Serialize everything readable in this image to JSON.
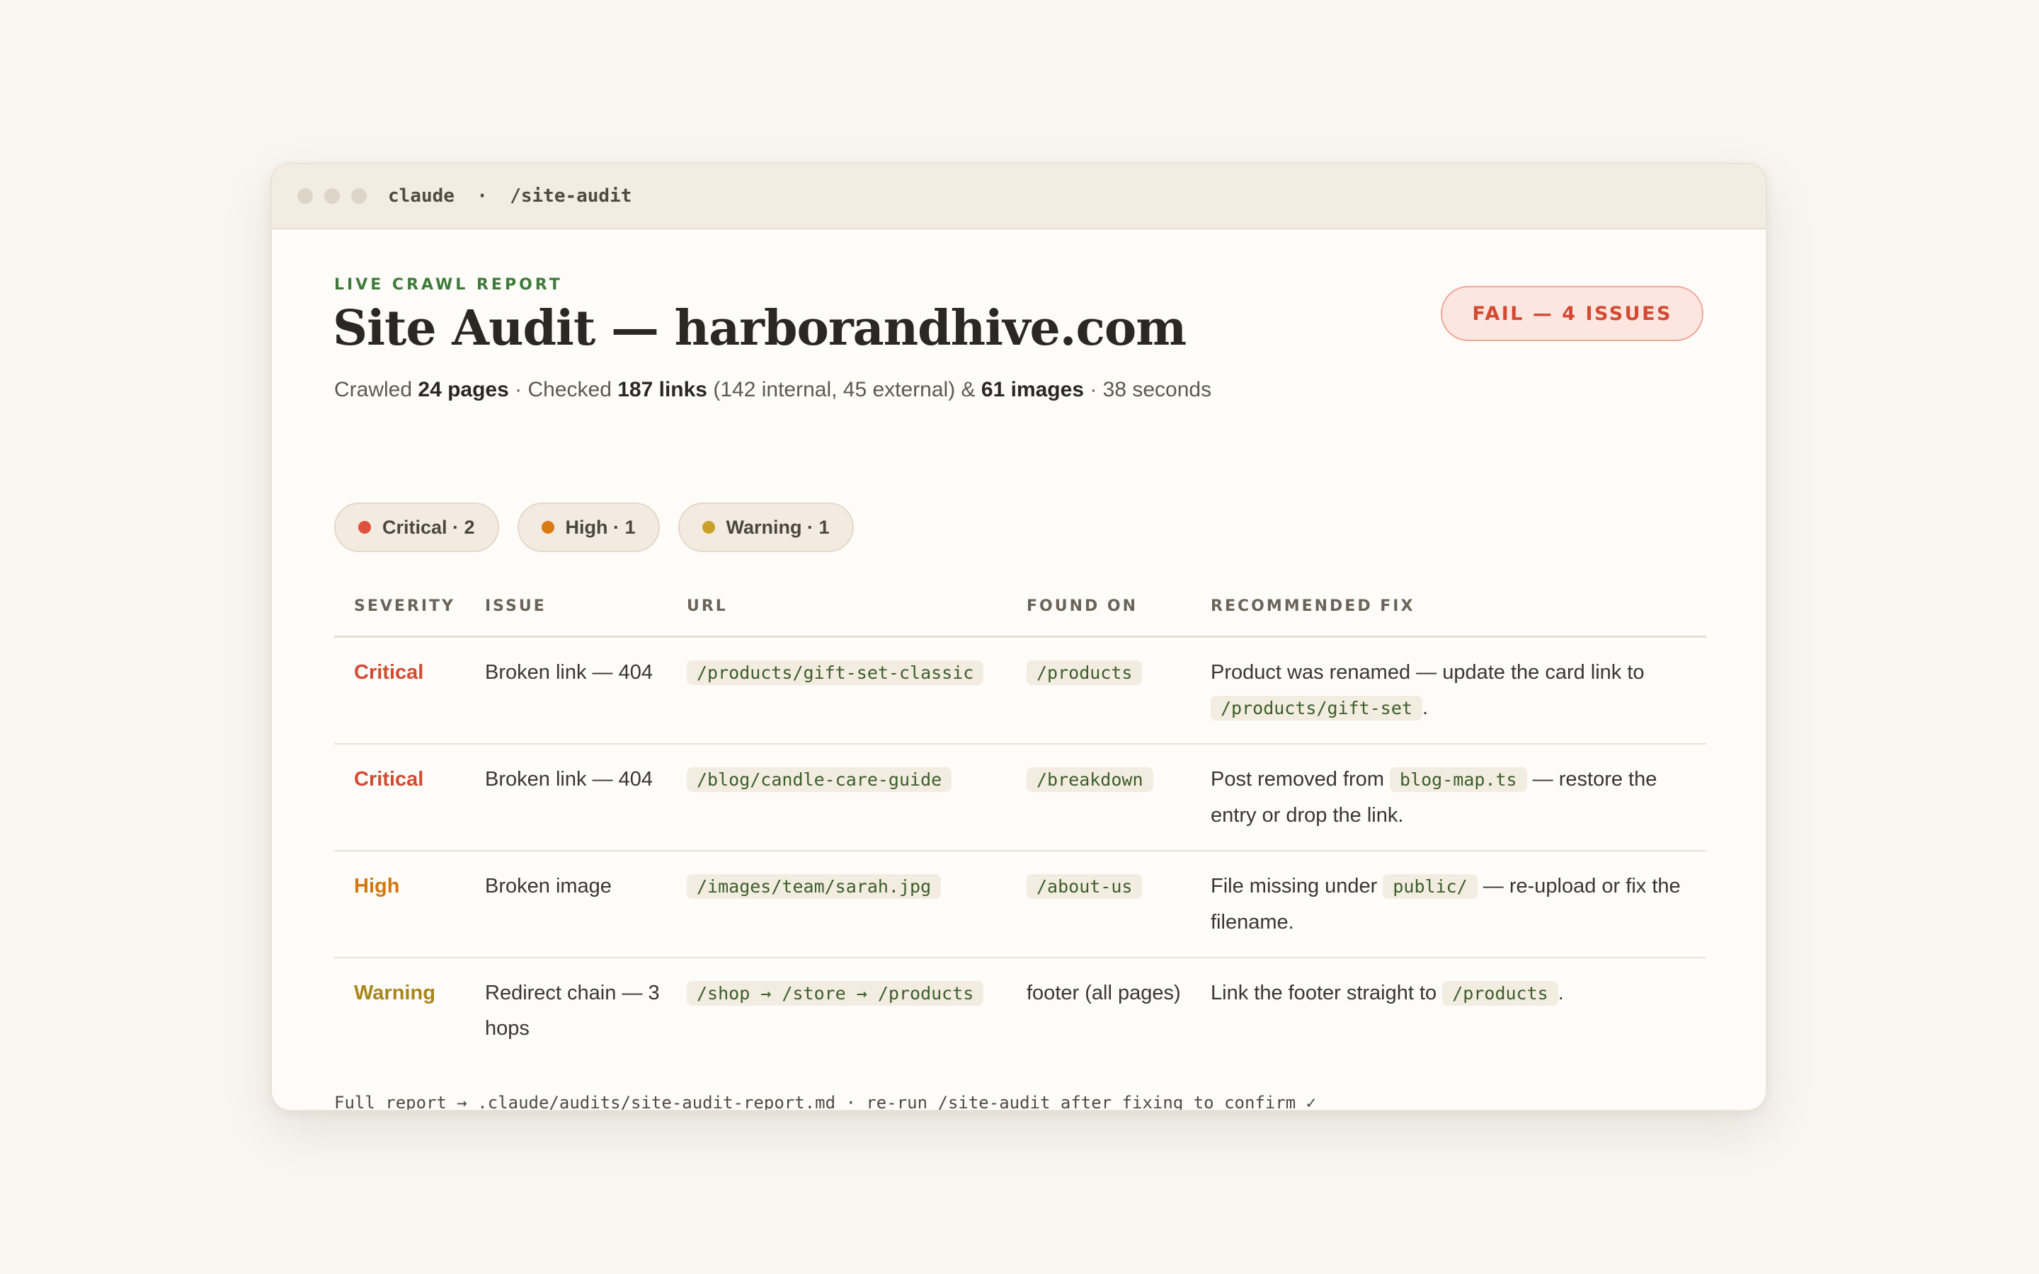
{
  "window": {
    "app": "claude",
    "separator": "·",
    "command": "/site-audit"
  },
  "header": {
    "eyebrow": "LIVE CRAWL REPORT",
    "title": "Site Audit — harborandhive.com",
    "status_badge": "FAIL — 4 ISSUES",
    "status_color": "#d24a33"
  },
  "summary": {
    "crawled_label": "Crawled",
    "pages": "24 pages",
    "sep1": "· Checked",
    "links": "187 links",
    "links_detail": "(142 internal, 45 external) &",
    "images": "61 images",
    "duration": "· 38 seconds"
  },
  "severity_pills": [
    {
      "label": "Critical · 2",
      "color": "#e0503a"
    },
    {
      "label": "High · 1",
      "color": "#d97a12"
    },
    {
      "label": "Warning · 1",
      "color": "#c9a12a"
    }
  ],
  "table": {
    "headers": [
      "SEVERITY",
      "ISSUE",
      "URL",
      "FOUND ON",
      "RECOMMENDED FIX"
    ],
    "rows": [
      {
        "severity": "Critical",
        "severity_color": "#d24a33",
        "issue": "Broken link — 404",
        "url": "/products/gift-set-classic",
        "found_on": "/products",
        "found_on_is_code": true,
        "fix_before": "Product was renamed — update the card link to ",
        "fix_code": "/products/gift-set",
        "fix_after": "."
      },
      {
        "severity": "Critical",
        "severity_color": "#d24a33",
        "issue": "Broken link — 404",
        "url": "/blog/candle-care-guide",
        "found_on": "/breakdown",
        "found_on_is_code": true,
        "fix_before": "Post removed from ",
        "fix_code": "blog-map.ts",
        "fix_after": " — restore the entry or drop the link."
      },
      {
        "severity": "High",
        "severity_color": "#d2780f",
        "issue": "Broken image",
        "url": "/images/team/sarah.jpg",
        "found_on": "/about-us",
        "found_on_is_code": true,
        "fix_before": "File missing under ",
        "fix_code": "public/",
        "fix_after": " — re-upload or fix the filename."
      },
      {
        "severity": "Warning",
        "severity_color": "#a8861a",
        "issue": "Redirect chain — 3 hops",
        "url": "/shop → /store → /products",
        "found_on": "footer (all pages)",
        "found_on_is_code": false,
        "fix_before": "Link the footer straight to ",
        "fix_code": "/products",
        "fix_after": "."
      }
    ]
  },
  "footer": {
    "text": "Full report → .claude/audits/site-audit-report.md · re-run /site-audit after fixing to confirm ✓"
  }
}
